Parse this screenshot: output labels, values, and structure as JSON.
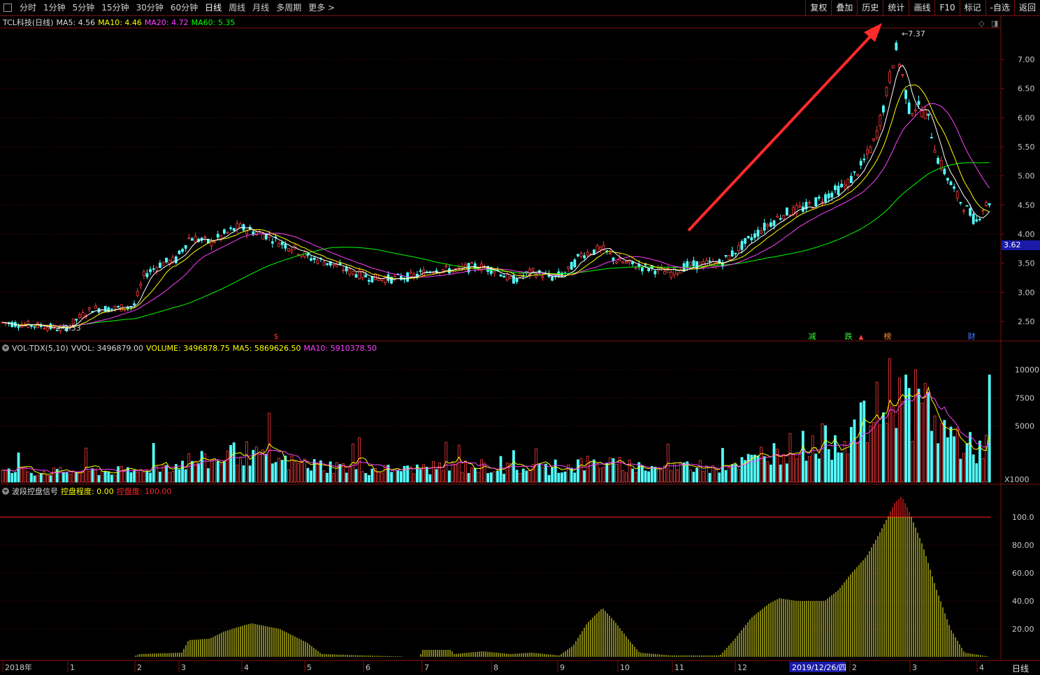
{
  "toolbar": {
    "periods": [
      "分时",
      "1分钟",
      "5分钟",
      "15分钟",
      "30分钟",
      "60分钟",
      "日线",
      "周线",
      "月线",
      "多周期",
      "更多 >"
    ],
    "active_period": "日线",
    "right_buttons": [
      "复权",
      "叠加",
      "历史",
      "统计",
      "画线",
      "F10",
      "标记",
      "-自选",
      "返回"
    ]
  },
  "main_panel": {
    "title": "TCL科技(日线)",
    "ma5_label": "MA5: 4.56",
    "ma10_label": "MA10: 4.46",
    "ma20_label": "MA20: 4.72",
    "ma60_label": "MA60: 5.35",
    "high_marker": "7.37",
    "low_marker": "2.33",
    "current_price": "3.62",
    "y_ticks": [
      "7.00",
      "6.50",
      "6.00",
      "5.50",
      "5.00",
      "4.50",
      "4.00",
      "3.50",
      "3.00",
      "2.50"
    ],
    "event_markers": [
      "$",
      "减",
      "跌",
      "榜",
      "财"
    ],
    "colors": {
      "ma5": "#ffffff",
      "ma10": "#ffff00",
      "ma20": "#ff40ff",
      "ma60": "#00ff00",
      "up": "#ff3c3c",
      "down": "#54ffff",
      "arrow": "#ff2a2a"
    }
  },
  "volume_panel": {
    "indicator": "VOL-TDX(5,10)",
    "vvol": "VVOL: 3496879.00",
    "volume": "VOLUME: 3496878.75",
    "ma5": "MA5: 5869626.50",
    "ma10": "MA10: 5910378.50",
    "y_ticks": [
      "10000",
      "7500",
      "5000"
    ],
    "unit": "X1000"
  },
  "signal_panel": {
    "name": "波段控盘信号",
    "degree_label": "控盘程度: 0.00",
    "control_label": "控盘度: 100.00",
    "y_ticks": [
      "100.0",
      "80.00",
      "60.00",
      "40.00",
      "20.00"
    ]
  },
  "x_axis": {
    "labels": [
      "2018年",
      "1",
      "2",
      "3",
      "4",
      "5",
      "6",
      "7",
      "8",
      "9",
      "10",
      "11",
      "12",
      "2019/12/26/四",
      "2",
      "3",
      "4"
    ],
    "period": "日线"
  },
  "chart_data": {
    "type": "candlestick",
    "title": "TCL科技(日线)",
    "ylim": [
      2.2,
      7.6
    ],
    "price_path": [
      [
        0,
        2.48
      ],
      [
        30,
        2.45
      ],
      [
        60,
        2.42
      ],
      [
        90,
        2.36
      ],
      [
        110,
        2.55
      ],
      [
        130,
        2.72
      ],
      [
        160,
        2.72
      ],
      [
        190,
        2.76
      ],
      [
        205,
        3.3
      ],
      [
        230,
        3.5
      ],
      [
        250,
        3.55
      ],
      [
        270,
        3.95
      ],
      [
        300,
        3.85
      ],
      [
        320,
        4.0
      ],
      [
        340,
        4.12
      ],
      [
        360,
        4.05
      ],
      [
        380,
        3.98
      ],
      [
        400,
        3.85
      ],
      [
        420,
        3.75
      ],
      [
        440,
        3.6
      ],
      [
        470,
        3.5
      ],
      [
        500,
        3.35
      ],
      [
        530,
        3.25
      ],
      [
        560,
        3.23
      ],
      [
        590,
        3.28
      ],
      [
        620,
        3.4
      ],
      [
        650,
        3.38
      ],
      [
        680,
        3.45
      ],
      [
        710,
        3.38
      ],
      [
        730,
        3.2
      ],
      [
        760,
        3.35
      ],
      [
        790,
        3.25
      ],
      [
        810,
        3.35
      ],
      [
        830,
        3.65
      ],
      [
        860,
        3.75
      ],
      [
        880,
        3.55
      ],
      [
        910,
        3.45
      ],
      [
        940,
        3.38
      ],
      [
        960,
        3.33
      ],
      [
        980,
        3.45
      ],
      [
        1000,
        3.48
      ],
      [
        1030,
        3.5
      ],
      [
        1060,
        3.8
      ],
      [
        1090,
        4.1
      ],
      [
        1120,
        4.35
      ],
      [
        1150,
        4.45
      ],
      [
        1180,
        4.65
      ],
      [
        1210,
        4.85
      ],
      [
        1230,
        5.15
      ],
      [
        1250,
        5.6
      ],
      [
        1265,
        6.3
      ],
      [
        1280,
        7.2
      ],
      [
        1290,
        6.7
      ],
      [
        1300,
        6.1
      ],
      [
        1310,
        6.2
      ],
      [
        1325,
        6.05
      ],
      [
        1340,
        5.3
      ],
      [
        1355,
        4.95
      ],
      [
        1370,
        4.6
      ],
      [
        1385,
        4.38
      ],
      [
        1395,
        4.2
      ],
      [
        1405,
        4.45
      ],
      [
        1418,
        4.6
      ]
    ],
    "high": 7.37,
    "low": 2.33,
    "volume_unit": "X1000",
    "signal_threshold": 100.0
  }
}
